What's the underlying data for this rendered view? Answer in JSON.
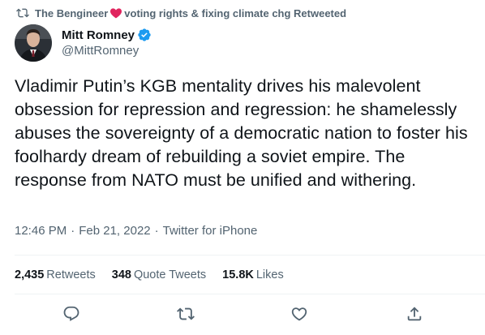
{
  "retweet_banner": {
    "user": "The Bengineer",
    "suffix": "voting rights & fixing climate chg Retweeted",
    "icons": [
      "retweet-icon",
      "heart-icon"
    ]
  },
  "author": {
    "display_name": "Mitt Romney",
    "handle": "@MittRomney",
    "verified_icon": "verified-badge-icon"
  },
  "tweet": {
    "text": "Vladimir Putin’s KGB mentality drives his malevolent obsession for repression and regression: he shamelessly abuses the sovereignty of a democratic nation to foster his foolhardy dream of rebuilding a soviet empire. The response from NATO must be unified and withering."
  },
  "meta": {
    "time": "12:46 PM",
    "date": "Feb 21, 2022",
    "source": "Twitter for iPhone",
    "separator": "·"
  },
  "stats": {
    "retweets_count": "2,435",
    "retweets_label": "Retweets",
    "quotes_count": "348",
    "quotes_label": "Quote Tweets",
    "likes_count": "15.8K",
    "likes_label": "Likes"
  },
  "actions": [
    "reply-icon",
    "retweet-icon",
    "like-icon",
    "share-icon"
  ],
  "colors": {
    "text": "#0f1419",
    "secondary": "#536471",
    "verified": "#1d9bf0",
    "heart": "#e0245e",
    "divider": "#eff3f4"
  }
}
